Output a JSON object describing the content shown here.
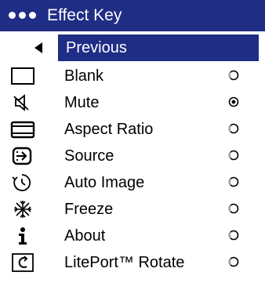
{
  "menu": {
    "title": "Effect Key",
    "previous_label": "Previous",
    "items": [
      {
        "label": "Blank",
        "icon": "blank-screen-icon",
        "selected": false
      },
      {
        "label": "Mute",
        "icon": "mute-speaker-icon",
        "selected": true
      },
      {
        "label": "Aspect Ratio",
        "icon": "aspect-ratio-icon",
        "selected": false
      },
      {
        "label": "Source",
        "icon": "source-input-icon",
        "selected": false
      },
      {
        "label": "Auto Image",
        "icon": "auto-image-icon",
        "selected": false
      },
      {
        "label": "Freeze",
        "icon": "freeze-snowflake-icon",
        "selected": false
      },
      {
        "label": "About",
        "icon": "info-icon",
        "selected": false
      },
      {
        "label": "LitePort™ Rotate",
        "icon": "rotate-icon",
        "selected": false
      }
    ]
  },
  "colors": {
    "highlight": "#1f2d85",
    "text": "#000000",
    "background": "#ffffff"
  }
}
